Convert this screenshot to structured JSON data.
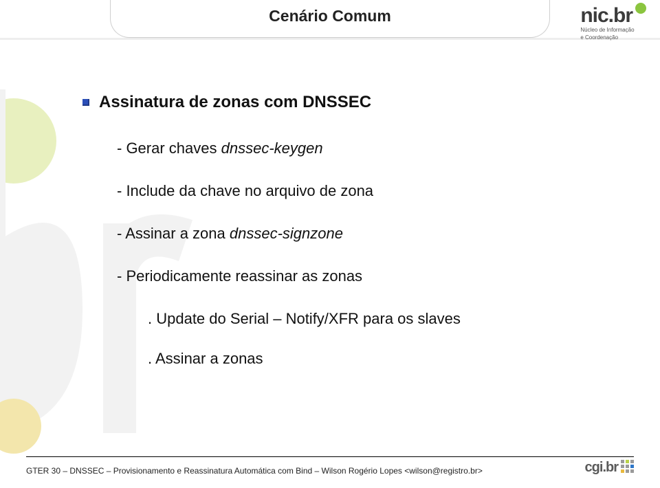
{
  "header": {
    "title": "Cenário Comum"
  },
  "logo_nic": {
    "main": "nic.br",
    "sub1": "Núcleo de Informação",
    "sub2": "e Coordenação"
  },
  "content": {
    "heading": "Assinatura de zonas com DNSSEC",
    "line1_text": "- Gerar chaves ",
    "line1_em": "dnssec-keygen",
    "line2": "- Include da chave no arquivo de zona",
    "line3_text": "- Assinar a zona ",
    "line3_em": "dnssec-signzone",
    "line4": "- Periodicamente reassinar as zonas",
    "sub1": ". Update do Serial – Notify/XFR para os slaves",
    "sub2": ". Assinar a zonas"
  },
  "footer": {
    "text": "GTER 30 – DNSSEC – Provisionamento e Reassinatura Automática com Bind – Wilson Rogério Lopes <wilson@registro.br>"
  },
  "cgi": {
    "text": "cgi.br"
  }
}
